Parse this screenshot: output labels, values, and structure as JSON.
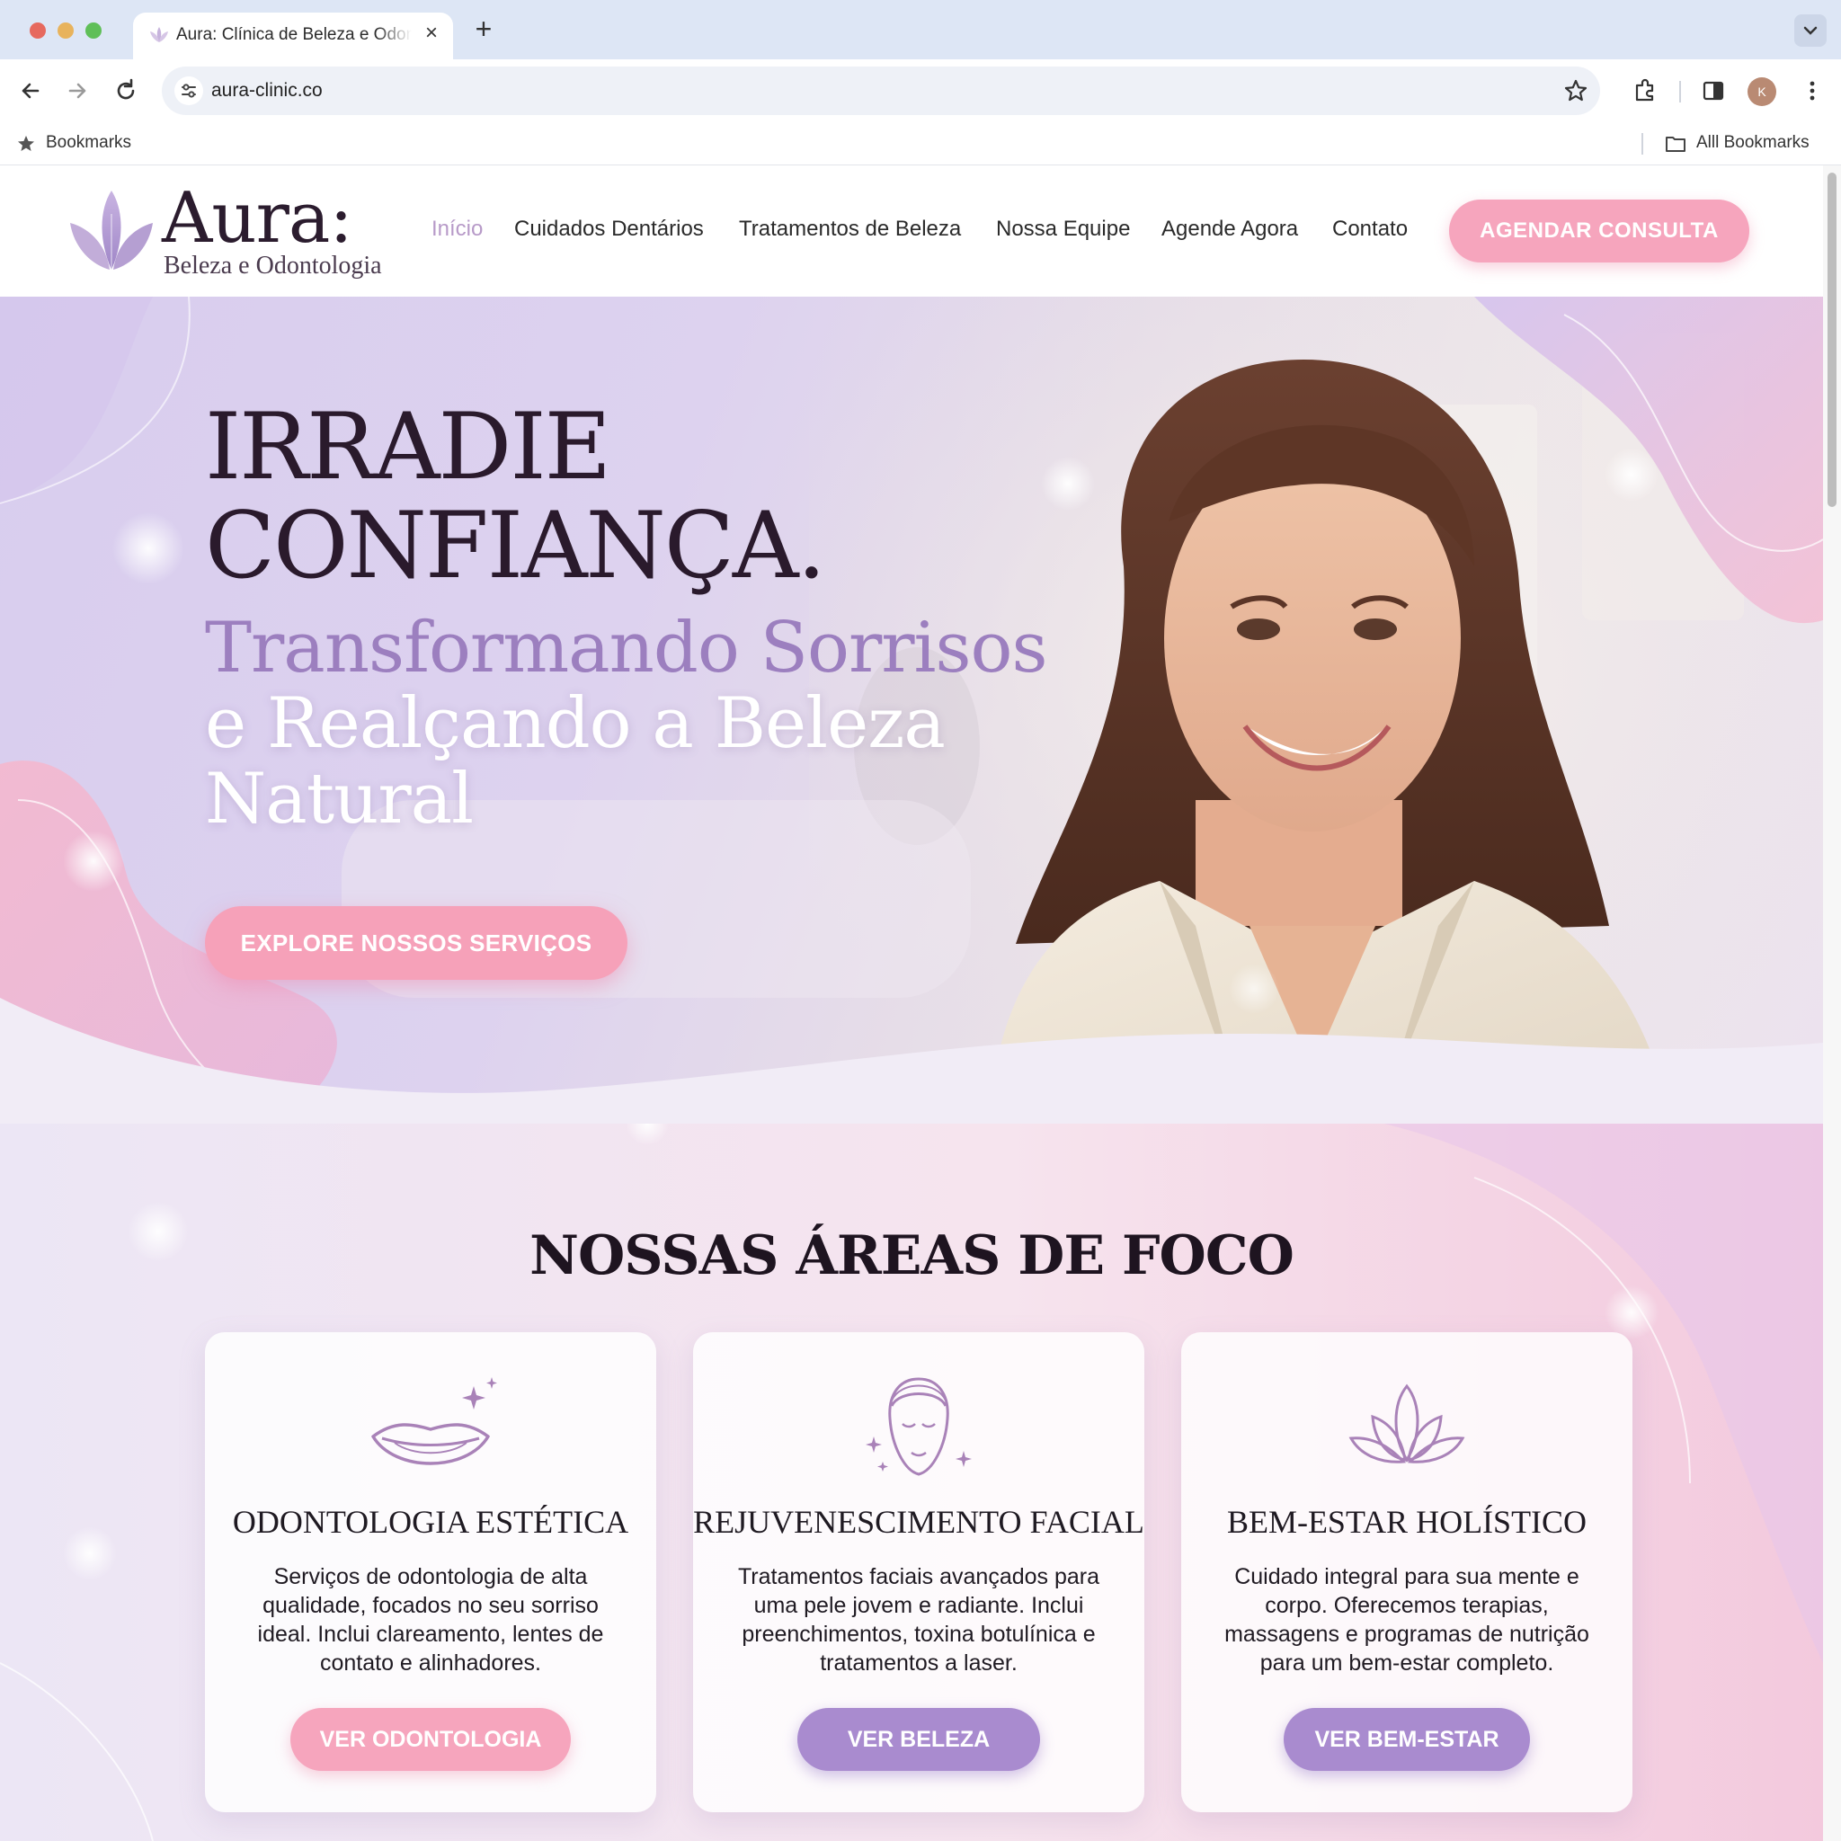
{
  "browser": {
    "tab_title": "Aura: Clínica de Beleza e Odontologia",
    "tab_close": "×",
    "new_tab": "+",
    "url": "aura-clinic.co",
    "profile_initial": "K",
    "bookmarks_label": "Bookmarks",
    "all_bookmarks_label": "Alll Bookmarks"
  },
  "header": {
    "logo_word": "Aura:",
    "logo_sub": "Beleza e Odontologia",
    "nav": [
      {
        "label": "Início",
        "active": true
      },
      {
        "label": "Cuidados Dentários"
      },
      {
        "label": "Tratamentos de Beleza"
      },
      {
        "label": "Nossa Equipe"
      },
      {
        "label": "Agende Agora"
      },
      {
        "label": "Contato"
      }
    ],
    "cta_label": "AGENDAR CONSULTA"
  },
  "hero": {
    "line1": "IRRADIE",
    "line2": "CONFIANÇA.",
    "sub1": "Transformando Sorrisos",
    "sub2": "e Realçando a Beleza",
    "sub3": "Natural",
    "cta_label": "EXPLORE NOSSOS SERVIÇOS"
  },
  "focus": {
    "title": "NOSSAS ÁREAS DE FOCO",
    "cards": [
      {
        "icon": "smile-lips-icon",
        "title": "ODONTOLOGIA ESTÉTICA",
        "text": "Serviços de odontologia de alta qualidade, focados no seu sorriso ideal. Inclui clareamento, lentes de contato e alinhadores.",
        "button": "VER ODONTOLOGIA"
      },
      {
        "icon": "face-icon",
        "title": "REJUVENESCIMENTO FACIAL",
        "text": "Tratamentos faciais avançados para uma pele jovem e radiante. Inclui preenchimentos, toxina botulínica e tratamentos a laser.",
        "button": "VER BELEZA"
      },
      {
        "icon": "lotus-icon",
        "title": "BEM-ESTAR HOLÍSTICO",
        "text": "Cuidado integral para sua mente e corpo. Oferecemos terapias, massagens e programas de nutrição para um bem-estar completo.",
        "button": "VER BEM-ESTAR"
      }
    ]
  },
  "colors": {
    "accent_pink": "#f6a5bd",
    "accent_purple": "#a98bcf",
    "text_dark": "#2a1a2c",
    "hero_subtitle_purple": "#9c7fbf"
  }
}
